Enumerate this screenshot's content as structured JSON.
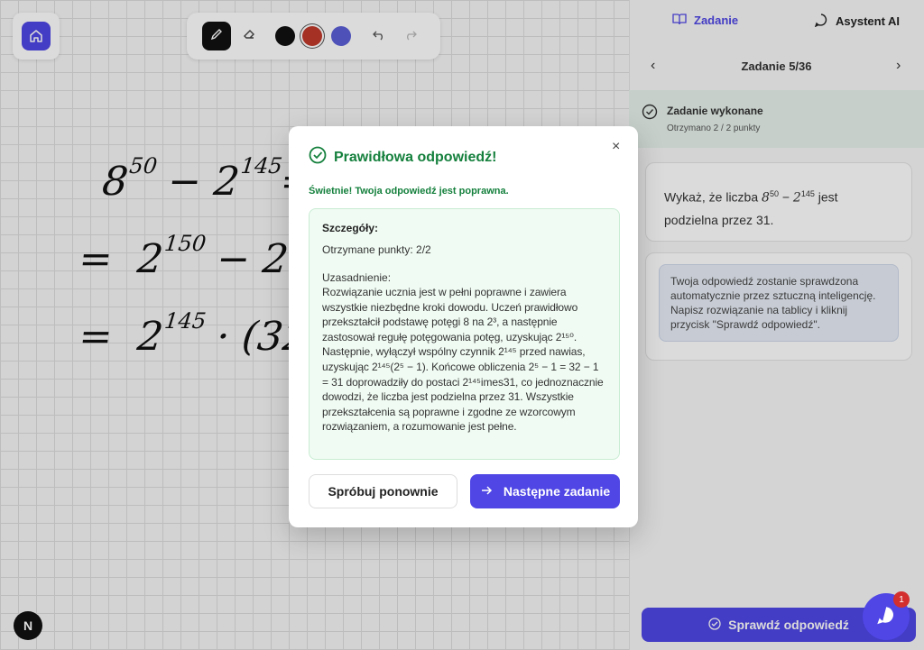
{
  "toolbar": {
    "colors": [
      "#111111",
      "#c0392b",
      "#5b5fd6"
    ],
    "tools": [
      "pencil-icon",
      "eraser-icon",
      "undo-icon",
      "redo-icon"
    ]
  },
  "canvas": {
    "lines": [
      {
        "a": "8",
        "aexp": "50",
        "op": "−",
        "b": "2",
        "bexp": "145",
        "tail": "="
      },
      {
        "lead": "=",
        "a": "2",
        "aexp": "150",
        "op": "−",
        "b": "2"
      },
      {
        "lead": "=",
        "a": "2",
        "aexp": "145",
        "op": "·",
        "b": "(32"
      }
    ]
  },
  "panel": {
    "tabs": {
      "task": "Zadanie",
      "assistant": "Asystent AI"
    },
    "nav_title": "Zadanie 5/36",
    "done_title": "Zadanie wykonane",
    "done_points": "Otrzymano 2 / 2 punkty",
    "task_text": "Wykaż, że liczba 8^50 − 2^145 jest podzielna przez 31.",
    "task_prefix": "Wykaż, że liczba ",
    "task_base1": "8",
    "task_exp1": "50",
    "task_op": " − ",
    "task_base2": "2",
    "task_exp2": "145",
    "task_suffix": " jest podzielna przez 31.",
    "info_text": "Twoja odpowiedź zostanie sprawdzona automatycznie przez sztuczną inteligencję. Napisz rozwiązanie na tablicy i kliknij przycisk \"Sprawdź odpowiedź\".",
    "check_button": "Sprawdź odpowiedź"
  },
  "chat": {
    "badge": "1"
  },
  "modal": {
    "title": "Prawidłowa odpowiedź!",
    "close": "×",
    "subtitle": "Świetnie! Twoja odpowiedź jest poprawna.",
    "details_label": "Szczegóły:",
    "points": "Otrzymane punkty: 2/2",
    "justification_label": "Uzasadnienie:",
    "justification": "Rozwiązanie ucznia jest w pełni poprawne i zawiera wszystkie niezbędne kroki dowodu. Uczeń prawidłowo przekształcił podstawę potęgi 8 na 2³, a następnie zastosował regułę potęgowania potęg, uzyskując 2¹⁵⁰. Następnie, wyłączył wspólny czynnik 2¹⁴⁵ przed nawias, uzyskując 2¹⁴⁵(2⁵ − 1). Końcowe obliczenia 2⁵ − 1 = 32 − 1 = 31 doprowadziły do postaci 2¹⁴⁵imes31, co jednoznacznie dowodzi, że liczba jest podzielna przez 31. Wszystkie przekształcenia są poprawne i zgodne ze wzorcowym rozwiązaniem, a rozumowanie jest pełne.",
    "retry_button": "Spróbuj ponownie",
    "next_button": "Następne zadanie"
  },
  "accent": "#4f46e5",
  "success": "#15803d"
}
